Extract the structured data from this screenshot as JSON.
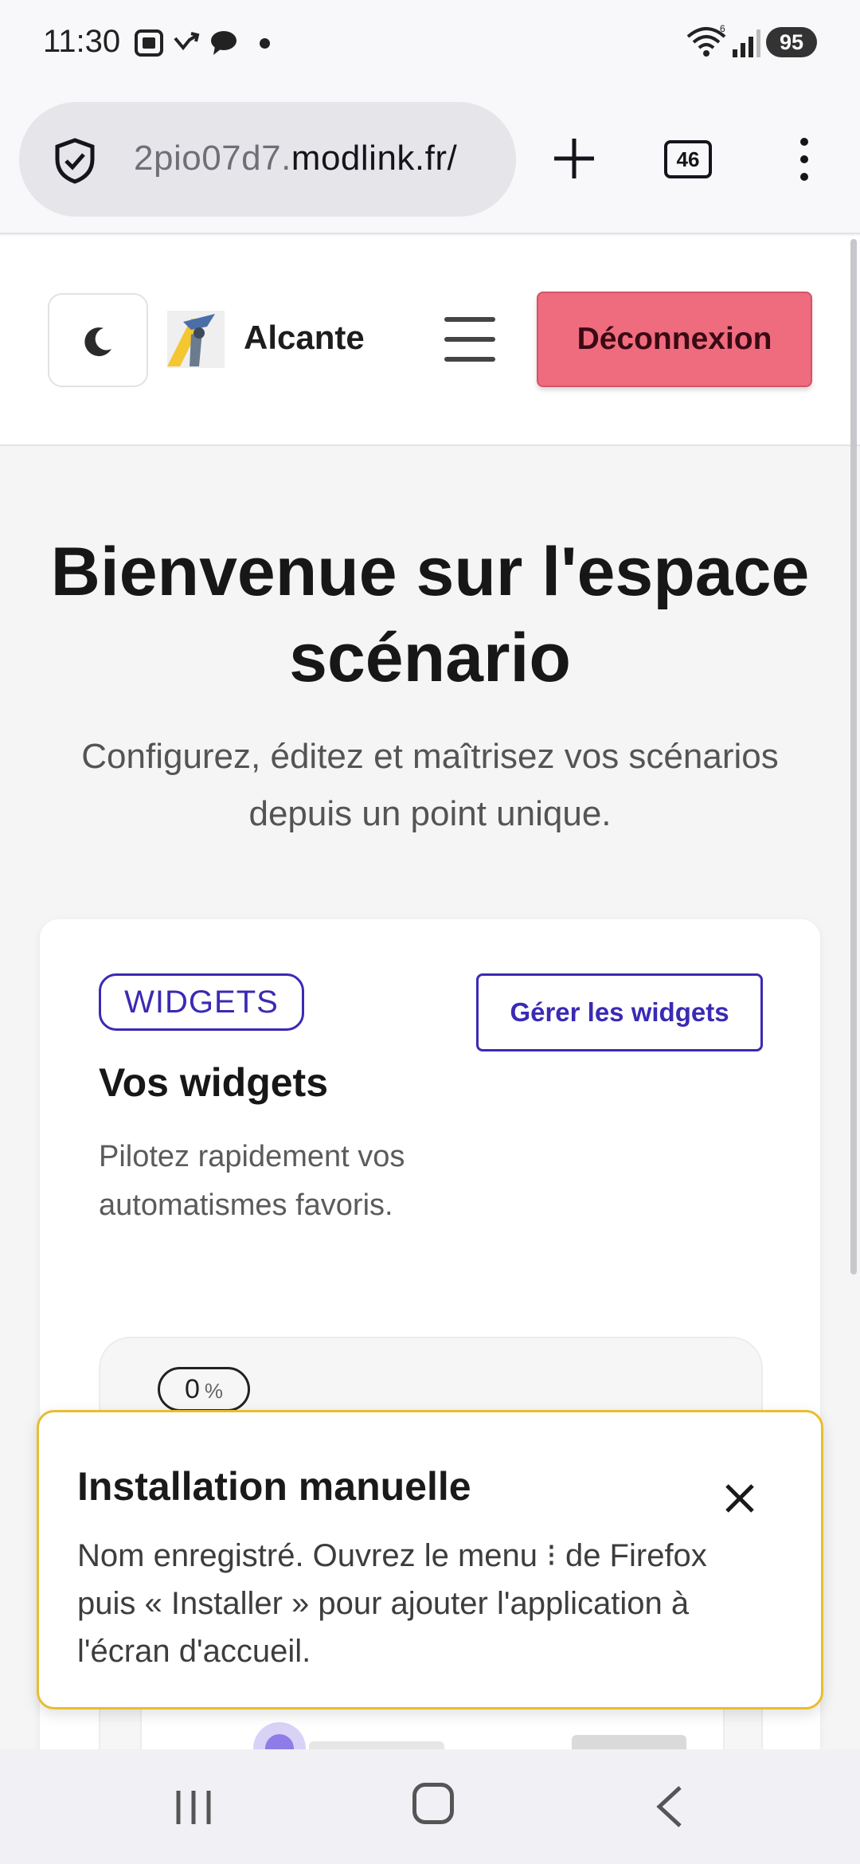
{
  "status_bar": {
    "time": "11:30",
    "battery": "95",
    "icons": [
      "screenshot-icon",
      "missed-call-icon",
      "chat-bubble-icon",
      "notification-dot-icon",
      "wifi-icon",
      "signal-icon"
    ]
  },
  "browser": {
    "url_subdomain": "2pio07d7.",
    "url_domain": "modlink.fr/",
    "tab_count": "46",
    "icons": [
      "shield-icon",
      "plus-icon",
      "tab-counter-icon",
      "more-vertical-icon"
    ]
  },
  "header": {
    "brand": "Alcante",
    "logout_label": "Déconnexion",
    "icons": [
      "moon-icon",
      "logo-icon",
      "hamburger-icon"
    ]
  },
  "hero": {
    "title": "Bienvenue sur l'espace scénario",
    "subtitle": "Configurez, éditez et maîtrisez vos scénarios depuis un point unique."
  },
  "widgets_card": {
    "badge": "WIDGETS",
    "manage_label": "Gérer les widgets",
    "title": "Vos widgets",
    "description": "Pilotez rapidement vos automatismes favoris.",
    "percent_value": "0",
    "percent_unit": "%"
  },
  "toast": {
    "title": "Installation manuelle",
    "message": "Nom enregistré. Ouvrez le menu ⁝ de Firefox puis « Installer » pour ajouter l'application à l'écran d'accueil."
  },
  "colors": {
    "logout_bg": "#ee6c7e",
    "accent": "#3a2ab4",
    "toast_border": "#e8bd2f"
  }
}
